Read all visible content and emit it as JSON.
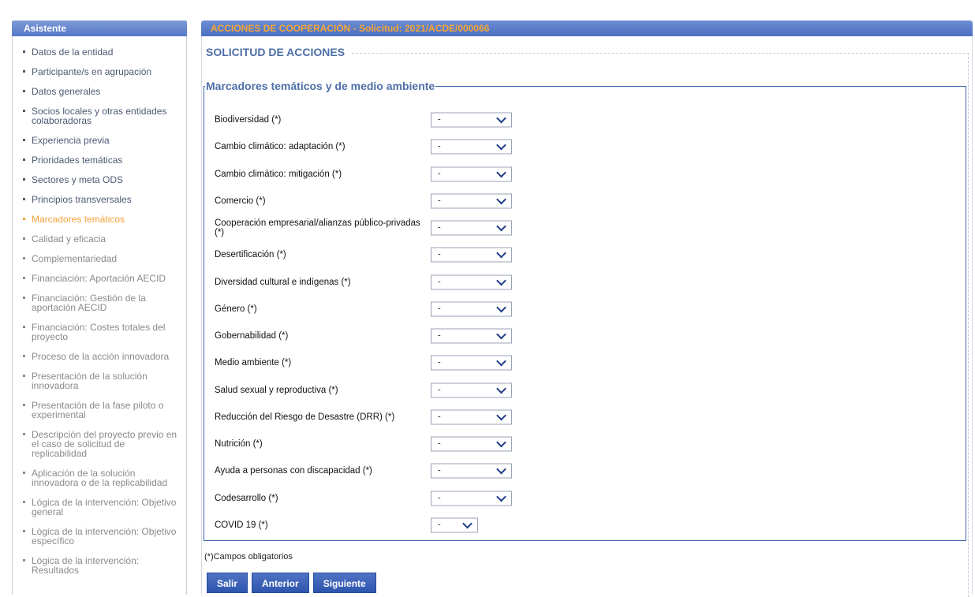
{
  "sidebar": {
    "title": "Asistente",
    "items": [
      {
        "label": "Datos de la entidad",
        "state": "link"
      },
      {
        "label": "Participante/s en agrupación",
        "state": "link"
      },
      {
        "label": "Datos generales",
        "state": "link"
      },
      {
        "label": "Socios locales y otras entidades colaboradoras",
        "state": "link"
      },
      {
        "label": "Experiencia previa",
        "state": "link"
      },
      {
        "label": "Prioridades temáticas",
        "state": "link"
      },
      {
        "label": "Sectores y meta ODS",
        "state": "link"
      },
      {
        "label": "Principios transversales",
        "state": "link"
      },
      {
        "label": "Marcadores temáticos",
        "state": "current"
      },
      {
        "label": "Calidad y eficacia",
        "state": "disabled"
      },
      {
        "label": "Complementariedad",
        "state": "disabled"
      },
      {
        "label": "Financiación: Aportación AECID",
        "state": "disabled"
      },
      {
        "label": "Financiación: Gestión de la aportación AECID",
        "state": "disabled"
      },
      {
        "label": "Financiación: Costes totales del proyecto",
        "state": "disabled"
      },
      {
        "label": "Proceso de la acción innovadora",
        "state": "disabled"
      },
      {
        "label": "Presentación de la solución innovadora",
        "state": "disabled"
      },
      {
        "label": "Presentación de la fase piloto o experimental",
        "state": "disabled"
      },
      {
        "label": "Descripción del proyecto previo en el caso de solicitud de replicabilidad",
        "state": "disabled"
      },
      {
        "label": "Aplicación de la solución innovadora o de la replicabilidad",
        "state": "disabled"
      },
      {
        "label": "Lógica de la intervención: Objetivo general",
        "state": "disabled"
      },
      {
        "label": "Lógica de la intervención: Objetivo específico",
        "state": "disabled"
      },
      {
        "label": "Lógica de la intervención: Resultados",
        "state": "disabled"
      }
    ]
  },
  "main": {
    "header": "ACCIONES DE COOPERACIÓN - Solicitud: 2021/ACDE/000066",
    "section_title": "SOLICITUD DE ACCIONES",
    "fieldset_legend": "Marcadores temáticos y de medio ambiente",
    "rows": [
      {
        "label": "Biodiversidad (*)",
        "value": "-"
      },
      {
        "label": "Cambio climático: adaptación (*)",
        "value": "-"
      },
      {
        "label": "Cambio climático: mitigación (*)",
        "value": "-"
      },
      {
        "label": "Comercio (*)",
        "value": "-"
      },
      {
        "label": "Cooperación empresarial/alianzas público-privadas (*)",
        "value": "-"
      },
      {
        "label": "Desertificación (*)",
        "value": "-"
      },
      {
        "label": "Diversidad cultural e indígenas (*)",
        "value": "-"
      },
      {
        "label": "Género (*)",
        "value": "-"
      },
      {
        "label": "Gobernabilidad (*)",
        "value": "-"
      },
      {
        "label": "Medio ambiente (*)",
        "value": "-"
      },
      {
        "label": "Salud sexual y reproductiva (*)",
        "value": "-"
      },
      {
        "label": "Reducción del Riesgo de Desastre (DRR) (*)",
        "value": "-"
      },
      {
        "label": "Nutrición (*)",
        "value": "-"
      },
      {
        "label": "Ayuda a personas con discapacidad (*)",
        "value": "-"
      },
      {
        "label": "Codesarrollo (*)",
        "value": "-"
      },
      {
        "label": "COVID 19 (*)",
        "value": "-",
        "size": "small"
      }
    ],
    "required_note": "(*)Campos obligatorios",
    "buttons": {
      "exit": "Salir",
      "previous": "Anterior",
      "next": "Siguiente"
    }
  },
  "colors": {
    "header_blue": "#4b6fc2",
    "header_text_orange": "#f7a634",
    "current_item_orange": "#f2a13a",
    "link_dark": "#4c5973",
    "disabled_gray": "#8a8a8a",
    "title_blue": "#4d6fa8",
    "chevron_blue": "#1f3f86"
  },
  "icons": {
    "select_arrow": "chevron-down-icon",
    "nav_bullet": "bullet-square"
  }
}
